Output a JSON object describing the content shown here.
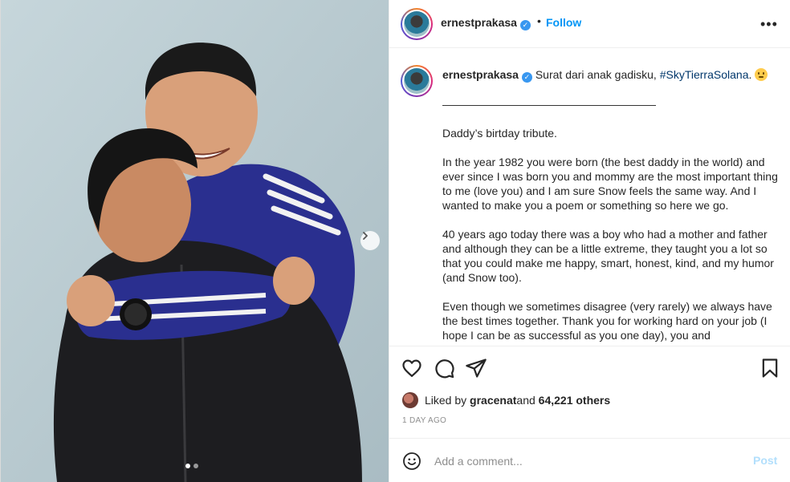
{
  "post": {
    "username": "ernestprakasa",
    "follow_label": "Follow",
    "separator": "•",
    "more_label": "•••"
  },
  "caption": {
    "username": "ernestprakasa",
    "intro": "Surat dari anak gadisku, ",
    "hashtag": "#SkyTierraSolana",
    "intro_end": ".",
    "rule": "———————————————————",
    "paragraphs": [
      "Daddy’s birtday tribute.",
      "In the year 1982 you were born (the best daddy in the world) and ever since I was born you and mommy are the most important thing to me (love you) and I am sure Snow feels the same way. And I wanted to make you a poem or something so here we go.",
      "40 years ago today there was a boy who had a mother and father and although they can be a little extreme, they taught you a lot so that you could make me happy, smart, honest, kind, and my humor (and Snow too).",
      "Even though we sometimes disagree (very rarely) we always have the best times together. Thank you for working hard on your job (I hope I can be as successful as you one day), you and"
    ]
  },
  "icons": {
    "like": "heart-icon",
    "comment": "comment-icon",
    "share": "send-icon",
    "save": "bookmark-icon",
    "next": "chevron-right-icon",
    "emoji": "smiley-icon",
    "verified": "verified-badge-icon"
  },
  "likes": {
    "prefix": "Liked by ",
    "user": "gracenat",
    "middle": " and ",
    "count": "64,221 others"
  },
  "timestamp": "1 DAY AGO",
  "comment": {
    "placeholder": "Add a comment...",
    "post_label": "Post"
  },
  "carousel": {
    "slides": 2,
    "active_index": 0
  },
  "colors": {
    "link_blue": "#0095f6",
    "hashtag": "#00376b",
    "verified": "#3897f0",
    "post_disabled": "#b2dffc",
    "muted": "#8e8e8e"
  }
}
